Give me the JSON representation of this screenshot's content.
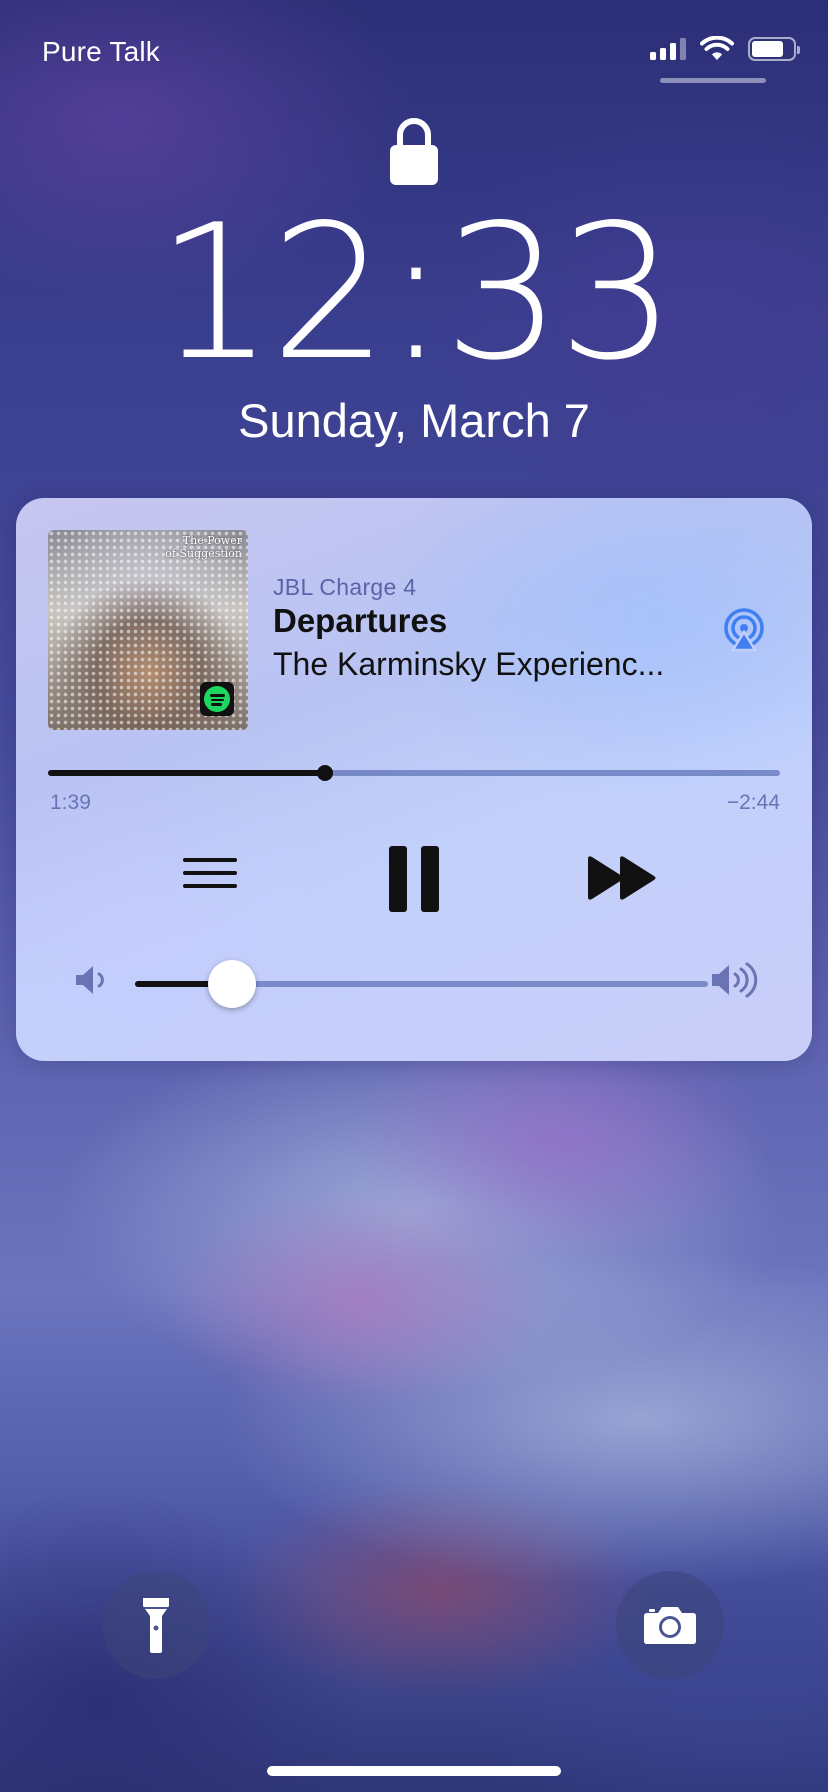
{
  "status_bar": {
    "carrier": "Pure Talk",
    "icons": [
      "cellular-signal-icon",
      "wifi-icon",
      "battery-icon"
    ],
    "signal_bars": 3,
    "battery_level": 0.78
  },
  "lock_screen": {
    "lock_icon": "lock-icon",
    "time": "12:33",
    "date": "Sunday, March 7"
  },
  "now_playing": {
    "device": "JBL Charge 4",
    "track": "Departures",
    "artist": "The Karminsky Experienc...",
    "album_art_text": "The Power of Suggestion",
    "source_app_icon": "spotify-icon",
    "airplay_icon": "airplay-icon",
    "elapsed": "1:39",
    "remaining": "−2:44",
    "progress": 0.378,
    "controls": [
      "menu-icon",
      "pause-icon",
      "fast-forward-icon"
    ],
    "volume": 0.17,
    "volume_icons": [
      "volume-low-icon",
      "volume-high-icon"
    ]
  },
  "shortcuts": {
    "left": "flashlight-icon",
    "right": "camera-icon"
  },
  "colors": {
    "accent_blue": "#3f7ff0",
    "secondary_text": "#6a74b5",
    "spotify_green": "#1ed760"
  }
}
